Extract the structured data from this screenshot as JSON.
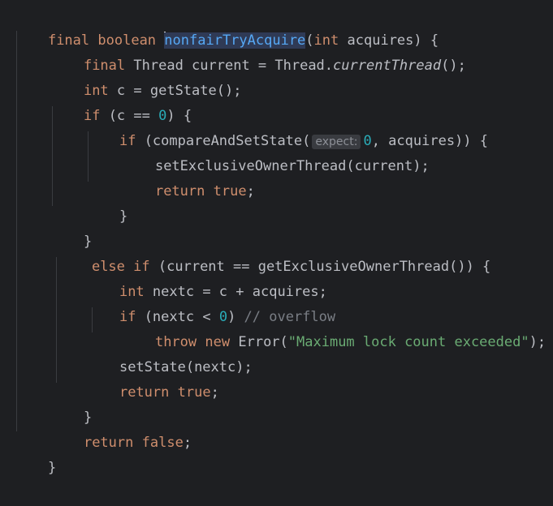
{
  "code": {
    "l1": [
      "final",
      "boolean",
      "nonfairTryAcquire",
      "(",
      "int",
      "acquires) {"
    ],
    "l2": [
      "final",
      "Thread current = Thread.",
      "currentThread",
      "();"
    ],
    "l3": [
      "int",
      "c = getState();"
    ],
    "l4": [
      "if",
      "(c == ",
      "0",
      ") {"
    ],
    "l5": [
      "if",
      "(compareAndSetState(",
      "expect:",
      "0",
      ", acquires)) {"
    ],
    "l6": [
      "setExclusiveOwnerThread(current);"
    ],
    "l7": [
      "return",
      "true",
      ";"
    ],
    "l8": [
      "}"
    ],
    "l9": [
      "}"
    ],
    "l10": [
      "else",
      "if",
      "(current == getExclusiveOwnerThread()) {"
    ],
    "l11": [
      "int",
      "nextc = c + acquires;"
    ],
    "l12": [
      "if",
      "(nextc < ",
      "0",
      ") ",
      "// overflow"
    ],
    "l13": [
      "throw",
      "new",
      "Error(",
      "\"Maximum lock count exceeded\"",
      ");"
    ],
    "l14": [
      "setState(nextc);"
    ],
    "l15": [
      "return",
      "true",
      ";"
    ],
    "l16": [
      "}"
    ],
    "l17": [
      "return",
      "false",
      ";"
    ],
    "l18": [
      "}"
    ]
  }
}
